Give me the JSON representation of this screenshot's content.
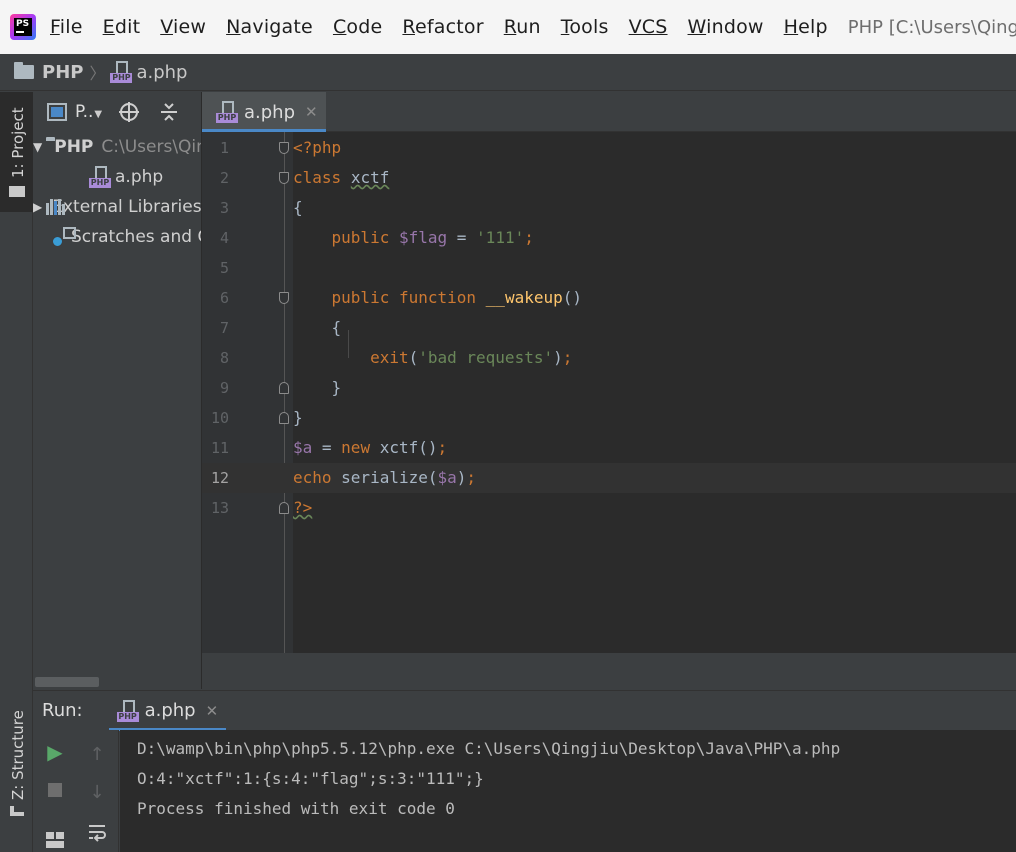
{
  "menu": {
    "items": [
      {
        "mnemonic": "F",
        "rest": "ile"
      },
      {
        "mnemonic": "E",
        "rest": "dit"
      },
      {
        "mnemonic": "V",
        "rest": "iew"
      },
      {
        "mnemonic": "N",
        "rest": "avigate"
      },
      {
        "mnemonic": "C",
        "rest": "ode"
      },
      {
        "mnemonic": "R",
        "rest": "efactor"
      },
      {
        "mnemonic": "R",
        "rest": "un"
      },
      {
        "mnemonic": "T",
        "rest": "ools"
      },
      {
        "mnemonic": "",
        "rest": "VCS"
      },
      {
        "mnemonic": "W",
        "rest": "indow"
      },
      {
        "mnemonic": "H",
        "rest": "elp"
      }
    ],
    "window_title": "PHP [C:\\Users\\Qingjiu\\Desktop\\Java\\PHP] - ...\\a.php - PhpStorm"
  },
  "breadcrumb": {
    "project": "PHP",
    "file": "a.php"
  },
  "left_stripe": {
    "project_label": "1: Project",
    "structure_label": "Z: Structure"
  },
  "project_panel": {
    "view_label": "P..",
    "tree": [
      {
        "label": "PHP",
        "path": "C:\\Users\\Qingjiu\\Desktop\\Java\\PHP"
      },
      {
        "label": "a.php"
      },
      {
        "label": "External Libraries"
      },
      {
        "label": "Scratches and Consoles"
      }
    ]
  },
  "editor": {
    "tab_label": "a.php",
    "line_numbers": [
      "1",
      "2",
      "3",
      "4",
      "5",
      "6",
      "7",
      "8",
      "9",
      "10",
      "11",
      "12",
      "13"
    ],
    "current_line": 12
  },
  "run_panel": {
    "label": "Run:",
    "tab_label": "a.php",
    "output": [
      "D:\\wamp\\bin\\php\\php5.5.12\\php.exe C:\\Users\\Qingjiu\\Desktop\\Java\\PHP\\a.php",
      "O:4:\"xctf\":1:{s:4:\"flag\";s:3:\"111\";}",
      "Process finished with exit code 0"
    ]
  },
  "colors": {
    "keyword": "#cc7832",
    "variable": "#9876aa",
    "string": "#6a8759",
    "function": "#ffc66d",
    "accent": "#4a88c7"
  }
}
